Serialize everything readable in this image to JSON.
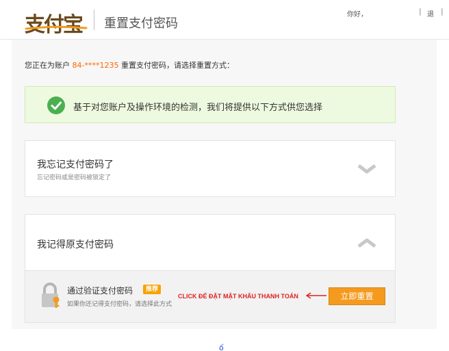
{
  "header": {
    "logo_text": "支付宝",
    "page_title": "重置支付密码",
    "greeting": "你好，",
    "separator": "|",
    "logout_label": "退"
  },
  "intro": {
    "prefix": "您正在为账户",
    "account": "84-****1235",
    "suffix": "重置支付密码，请选择重置方式："
  },
  "notice": {
    "text": "基于对您账户及操作环境的检测，我们将提供以下方式供您选择"
  },
  "cards": [
    {
      "title": "我忘记支付密码了",
      "subtitle": "忘记密码或是密码被锁定了",
      "icon": "chevron-down-icon"
    },
    {
      "title": "我记得原支付密码",
      "subtitle": "",
      "icon": "chevron-up-icon"
    }
  ],
  "option": {
    "title": "通过验证支付密码",
    "badge": "推荐",
    "subtitle": "如果你还记得支付密码，请选择此方式",
    "annotation": "CLICK ĐỂ ĐẶT MẬT KHẨU THANH TOÁN",
    "button_label": "立即重置",
    "icon": "lock-key-icon"
  },
  "bottom_glyph": "ố",
  "colors": {
    "accent": "#f49a1e",
    "account": "#ff6600",
    "annotation": "#e02020",
    "notice_bg": "#eefadf",
    "success": "#4caf50"
  }
}
